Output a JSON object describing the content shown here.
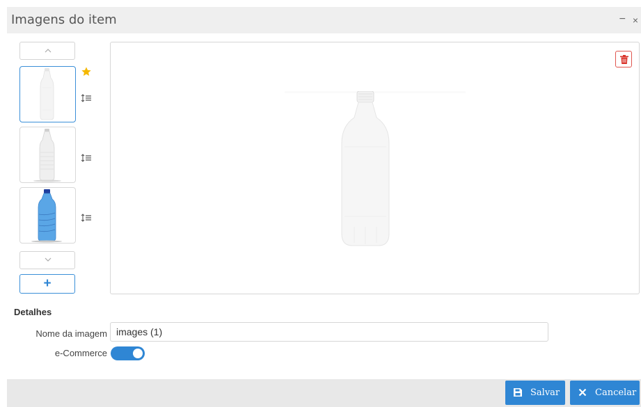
{
  "dialog": {
    "title": "Imagens do item",
    "minimize_glyph": "−",
    "close_glyph": "×"
  },
  "gallery": {
    "thumbnails": [
      {
        "alt": "clear bottle 2L",
        "selected": true,
        "primary": true
      },
      {
        "alt": "clear bottle small cap",
        "selected": false,
        "primary": false
      },
      {
        "alt": "blue water bottle",
        "selected": false,
        "primary": false
      }
    ],
    "add_glyph": "+"
  },
  "details": {
    "heading": "Detalhes",
    "name_label": "Nome da imagem",
    "name_value": "images (1)",
    "ecommerce_label": "e-Commerce",
    "ecommerce_enabled": true
  },
  "footer": {
    "save_label": "Salvar",
    "cancel_label": "Cancelar"
  },
  "colors": {
    "accent": "#2f86d4",
    "delete": "#e0554e",
    "star": "#f5b800"
  }
}
